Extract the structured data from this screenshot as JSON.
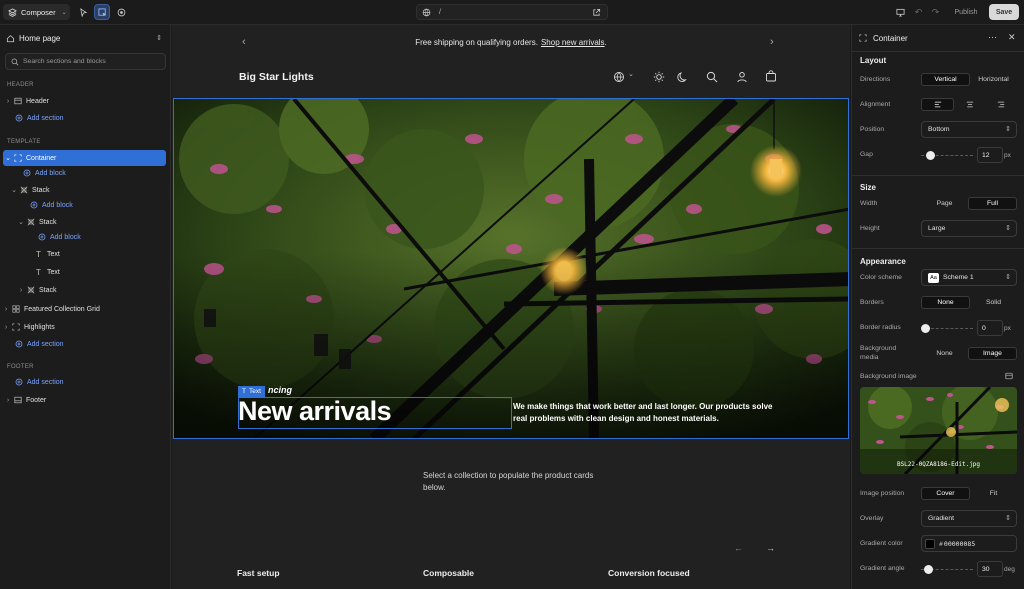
{
  "topbar": {
    "app_label": "Composer",
    "url_path": "/",
    "publish": "Publish",
    "save": "Save"
  },
  "sidebar": {
    "page_title": "Home page",
    "search_placeholder": "Search sections and blocks",
    "sections": {
      "header": "HEADER",
      "template": "TEMPLATE",
      "footer": "FOOTER"
    },
    "items": {
      "header": "Header",
      "add_section": "Add section",
      "container": "Container",
      "add_block": "Add block",
      "stack": "Stack",
      "text": "Text",
      "featured": "Featured Collection Grid",
      "highlights": "Highlights",
      "footer": "Footer"
    }
  },
  "preview": {
    "announcement": "Free shipping on qualifying orders.",
    "announcement_link": "Shop new arrivals",
    "announcement_end": ".",
    "brand": "Big Star Lights",
    "hero_kicker": "ncing",
    "hero_title": "New arrivals",
    "hero_text": "We make things that work better and last longer. Our products solve real problems with clean design and honest materials.",
    "selected_tag": "Text",
    "collection_msg": "Select a collection to populate the product cards below.",
    "features": [
      "Fast setup",
      "Composable",
      "Conversion focused"
    ]
  },
  "inspector": {
    "title": "Container",
    "layout": {
      "heading": "Layout",
      "directions_label": "Directions",
      "dir_options": [
        "Vertical",
        "Horizontal"
      ],
      "alignment_label": "Alignment",
      "position_label": "Position",
      "position_value": "Bottom",
      "gap_label": "Gap",
      "gap_value": "12",
      "gap_unit": "px"
    },
    "size": {
      "heading": "Size",
      "width_label": "Width",
      "width_options": [
        "Page",
        "Full"
      ],
      "height_label": "Height",
      "height_value": "Large"
    },
    "appearance": {
      "heading": "Appearance",
      "scheme_label": "Color scheme",
      "scheme_swatch": "Aa",
      "scheme_value": "Scheme 1",
      "borders_label": "Borders",
      "borders_options": [
        "None",
        "Solid"
      ],
      "radius_label": "Border radius",
      "radius_value": "0",
      "radius_unit": "px",
      "bgmedia_label": "Background media",
      "bgmedia_options": [
        "None",
        "Image"
      ],
      "bgimage_label": "Background image",
      "bgimage_file": "BSL22-0QZA8186-Edit.jpg",
      "imgpos_label": "Image position",
      "imgpos_options": [
        "Cover",
        "Fit"
      ],
      "overlay_label": "Overlay",
      "overlay_value": "Gradient",
      "gradcolor_label": "Gradient color",
      "gradcolor_value": "00000085",
      "gradcolor_hash": "#",
      "gradangle_label": "Gradient angle",
      "gradangle_value": "30",
      "gradangle_unit": "deg"
    }
  },
  "colors": {
    "accent": "#2f6fd6",
    "link": "#7aa3ff",
    "panel": "#1c1c1c"
  }
}
